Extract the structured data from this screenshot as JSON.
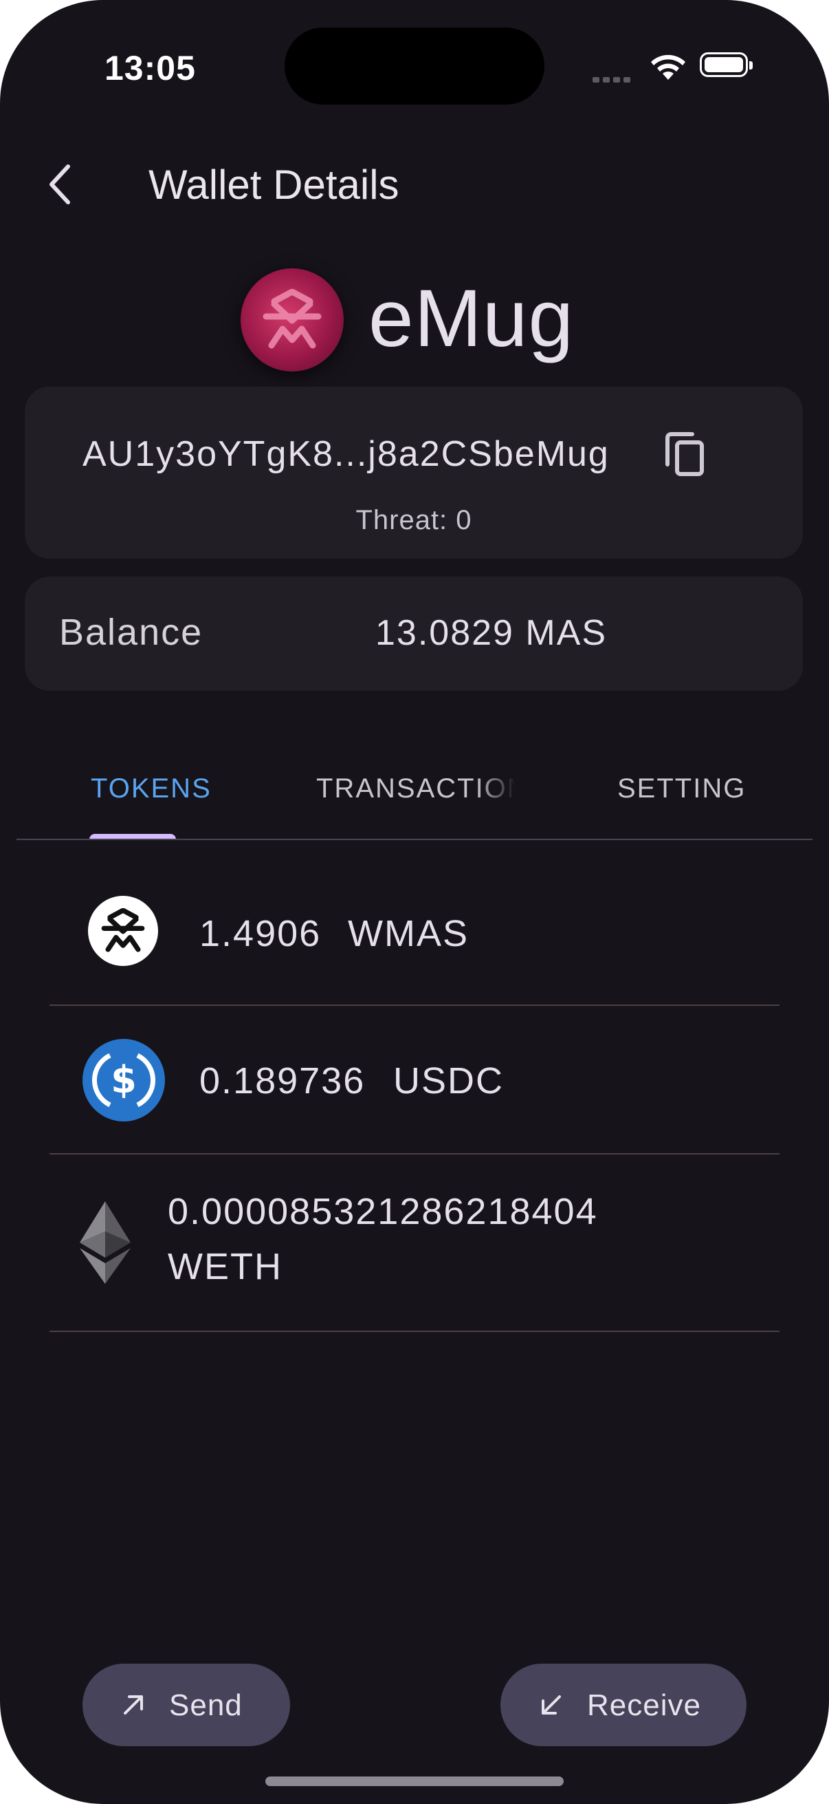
{
  "status_bar": {
    "time": "13:05"
  },
  "header": {
    "title": "Wallet Details"
  },
  "wallet": {
    "name": "eMug",
    "address": "AU1y3oYTgK8...j8a2CSbeMug",
    "threat_text": "Threat: 0"
  },
  "balance": {
    "label": "Balance",
    "value": "13.0829 MAS"
  },
  "tabs": [
    {
      "label": "TOKENS",
      "selected": true
    },
    {
      "label": "TRANSACTIONS",
      "selected": false
    },
    {
      "label": "SETTING",
      "selected": false
    }
  ],
  "tokens": [
    {
      "amount": "1.4906",
      "symbol": "WMAS",
      "icon": "massa-icon"
    },
    {
      "amount": "0.189736",
      "symbol": "USDC",
      "icon": "usdc-icon"
    },
    {
      "amount": "0.000085321286218404",
      "symbol": "WETH",
      "icon": "ethereum-icon"
    }
  ],
  "actions": {
    "send": "Send",
    "receive": "Receive"
  },
  "colors": {
    "background": "#16131a",
    "card": "#211e25",
    "accent_tab": "#5aa4f0",
    "indicator": "#d5bbff",
    "button": "#47435a",
    "usdc": "#2775ca"
  }
}
